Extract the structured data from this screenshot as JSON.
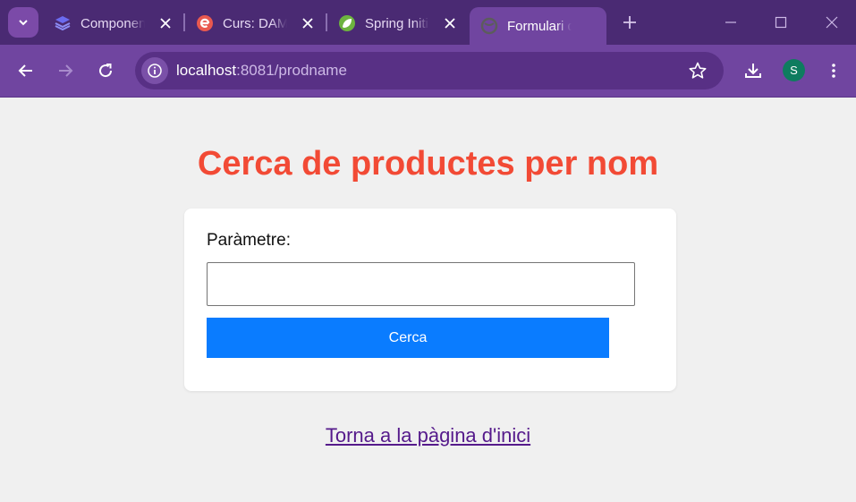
{
  "browser": {
    "tabs": [
      {
        "title": "Componen",
        "favicon": "layers-icon"
      },
      {
        "title": "Curs: DAM",
        "favicon": "e-logo-icon"
      },
      {
        "title": "Spring Initi",
        "favicon": "spring-leaf-icon"
      },
      {
        "title": "Formulari d",
        "favicon": "globe-icon"
      }
    ],
    "url_host": "localhost",
    "url_path": ":8081/prodname",
    "profile_initial": "S"
  },
  "page": {
    "heading": "Cerca de productes per nom",
    "form": {
      "label": "Paràmetre:",
      "input_value": "",
      "button_label": "Cerca"
    },
    "back_link": "Torna a la pàgina d'inici"
  },
  "colors": {
    "accent_purple": "#7045a0",
    "heading": "#f24a35",
    "button": "#0a7cff",
    "link": "#551a8b"
  }
}
